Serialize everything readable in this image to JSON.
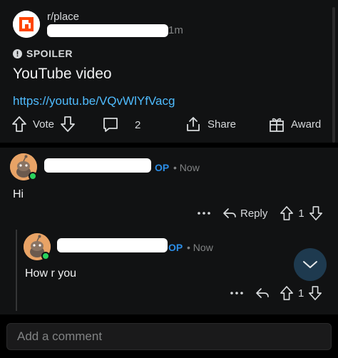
{
  "post": {
    "subreddit": "r/place",
    "time": "1m",
    "spoiler_label": "SPOILER",
    "title": "YouTube video",
    "link": "https://youtu.be/VQvWlYfVacg",
    "actions": {
      "vote_label": "Vote",
      "comment_count": "2",
      "share_label": "Share",
      "award_label": "Award"
    }
  },
  "comments": [
    {
      "op_badge": "OP",
      "time": "• Now",
      "text": "Hi",
      "reply_label": "Reply",
      "score": "1"
    },
    {
      "op_badge": "OP",
      "time": "• Now",
      "text": "How r you",
      "score": "1"
    }
  ],
  "composer": {
    "placeholder": "Add a comment"
  },
  "colors": {
    "accent_link": "#4fbcff",
    "op_blue": "#2b8de6",
    "online_green": "#2ad35c",
    "brand_orange": "#ff4500"
  }
}
